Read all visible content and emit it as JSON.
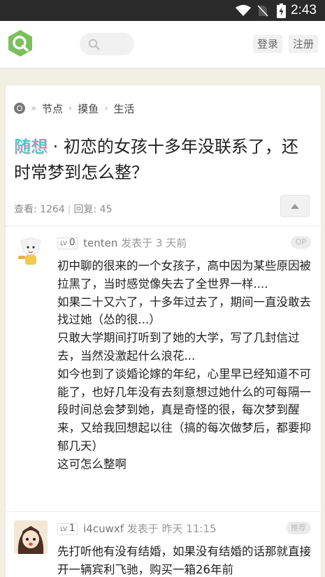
{
  "status_bar": {
    "time": "2:43",
    "icons": [
      "wifi-icon",
      "no-sim-icon",
      "battery-charging-icon"
    ]
  },
  "header": {
    "logo_icon": "q-logo-icon",
    "search_icon": "search-icon",
    "login_label": "登录",
    "register_label": "注册"
  },
  "topic": {
    "breadcrumb": [
      "节点",
      "摸鱼",
      "生活"
    ],
    "tag": "随想",
    "title": "· 初恋的女孩十多年没联系了，还时常梦到怎么整？",
    "views_label": "查看: 1264",
    "replies_label": "回复: 45"
  },
  "replies": [
    {
      "level_prefix": "LV",
      "level": "0",
      "username": "tenten",
      "time": "发表于 3 天前",
      "badge": "OP",
      "content_lines": [
        "初中聊的很来的一个女孩子，高中因为某些原因被拉黑了，当时感觉像失去了全世界一样....",
        "如果二十又六了，十多年过去了，期间一直没敢去找过她（怂的很...）",
        "只敢大学期间打听到了她的大学，写了几封信过去，当然没激起什么浪花...",
        "如今也到了谈婚论嫁的年纪，心里早已经知道不可能了，也好几年没有去刻意想过她什么的可每隔一段时间总会梦到她，真是奇怪的很，每次梦到醒来，又给我回想起以往（搞的每次做梦后，都要抑郁几天）",
        "这可怎么整啊"
      ]
    },
    {
      "level_prefix": "LV",
      "level": "1",
      "username": "i4cuwxf",
      "time": "发表于 昨天 11:15",
      "badge": "推荐",
      "content_lines": [
        "先打听他有没有结婚，如果没有结婚的话那就直接开一辆宾利飞驰，购买一箱26年前"
      ]
    }
  ],
  "colors": {
    "accent": "#7cc05d",
    "tag": "#3ac1d2",
    "page_bg": "#f2efe3"
  }
}
